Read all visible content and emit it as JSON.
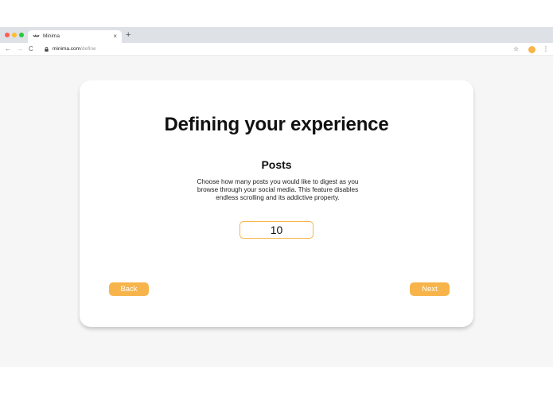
{
  "browser": {
    "tab": {
      "title": "Minima",
      "close_glyph": "×",
      "favicon": "minima-logo-icon"
    },
    "new_tab_glyph": "+",
    "nav": {
      "back_glyph": "←",
      "forward_glyph": "→",
      "reload_glyph": "C"
    },
    "url": {
      "host": "minima.com",
      "path": "/define"
    },
    "star_glyph": "☆",
    "menu_glyph": "⋮"
  },
  "page": {
    "title": "Defining your experience",
    "section_title": "Posts",
    "description": "Choose how many posts you would like to digest as you browse through your social media. This feature disables endless scrolling and its addictive property.",
    "posts_input": {
      "value": "10"
    },
    "back_label": "Back",
    "next_label": "Next"
  },
  "colors": {
    "accent": "#f7b44a",
    "tab_strip": "#dee1e6",
    "page_background": "#f6f6f6",
    "card": "#ffffff"
  }
}
